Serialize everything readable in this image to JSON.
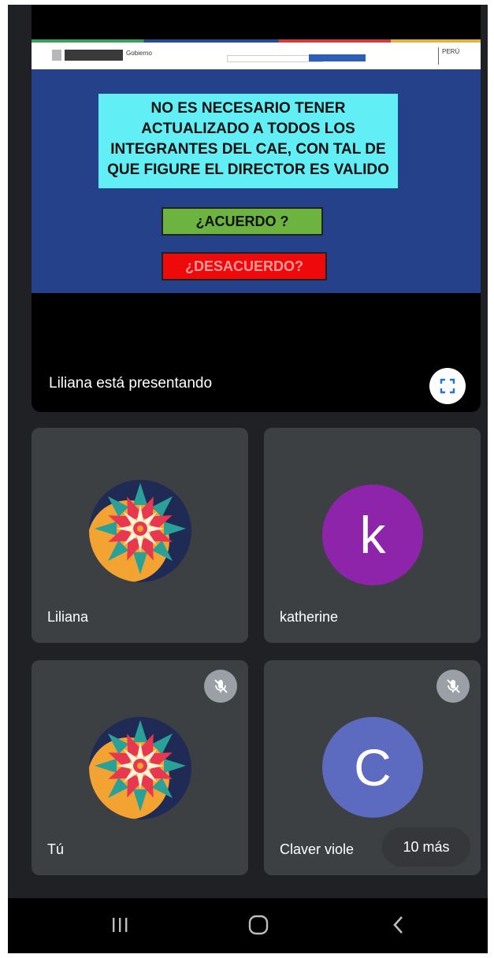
{
  "presentation": {
    "slide": {
      "header_logo_text": "Gobierno",
      "header_right_text": "PERÚ",
      "message": "NO ES NECESARIO TENER\nACTUALIZADO  A TODOS LOS\nINTEGRANTES DEL CAE, CON TAL DE\nQUE FIGURE EL DIRECTOR ES VALIDO",
      "agree_label": "¿ACUERDO ?",
      "disagree_label": "¿DESACUERDO?"
    },
    "presenter_label": "Liliana está presentando",
    "fullscreen_icon": "fullscreen-icon"
  },
  "participants": [
    {
      "name": "Liliana",
      "avatar": "mandala-image",
      "muted": false
    },
    {
      "name": "katherine",
      "avatar_letter": "k",
      "avatar_color": "#8e24aa",
      "muted": false
    },
    {
      "name": "Tú",
      "avatar": "mandala-image",
      "muted": true
    },
    {
      "name": "Claver viole",
      "avatar_letter": "C",
      "avatar_color": "#5c6bc0",
      "muted": true,
      "more_label": "10 más"
    }
  ],
  "colors": {
    "background": "#202124",
    "tile": "#3c4043",
    "slide_bg": "#24418a",
    "agree_button": "#6db33f",
    "disagree_button": "#ee0a0a"
  },
  "navbar": {
    "icons": [
      "recent-apps-icon",
      "home-icon",
      "back-icon"
    ]
  }
}
